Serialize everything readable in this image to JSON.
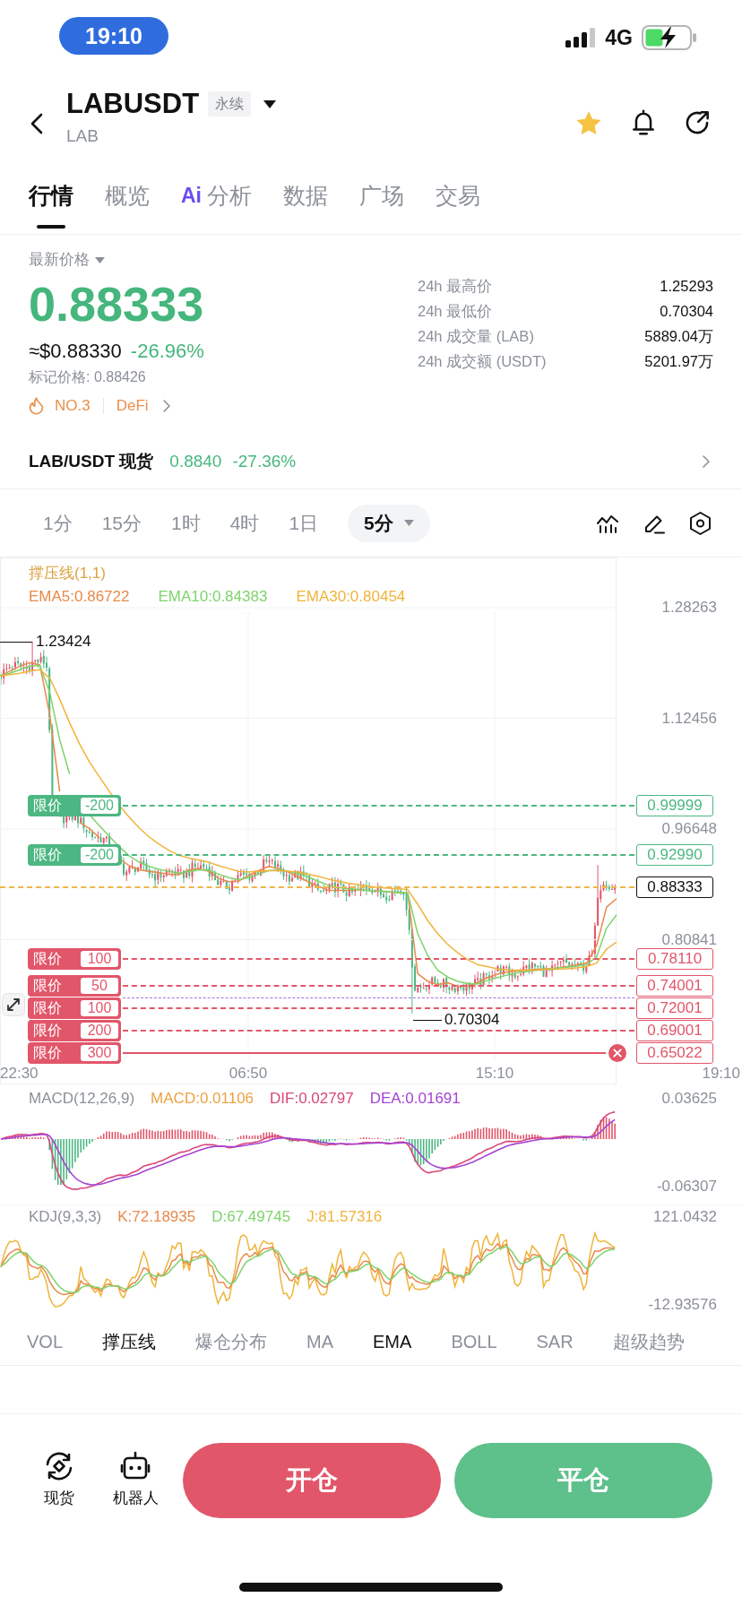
{
  "status_bar": {
    "time": "19:10",
    "network": "4G"
  },
  "header": {
    "symbol": "LABUSDT",
    "contract_type": "永续",
    "base_asset": "LAB",
    "favorite": true
  },
  "tabs": [
    {
      "label": "行情",
      "selected": true
    },
    {
      "label": "概览",
      "selected": false
    },
    {
      "label": "分析",
      "badge": "Ai",
      "selected": false
    },
    {
      "label": "数据",
      "selected": false
    },
    {
      "label": "广场",
      "selected": false
    },
    {
      "label": "交易",
      "selected": false
    }
  ],
  "price": {
    "label": "最新价格",
    "last": "0.88333",
    "usd": "≈$0.88330",
    "change": "-26.96%",
    "mark_price": "标记价格: 0.88426",
    "rank": "NO.3",
    "sector": "DeFi"
  },
  "stats": [
    {
      "label": "24h 最高价",
      "value": "1.25293"
    },
    {
      "label": "24h 最低价",
      "value": "0.70304"
    },
    {
      "label": "24h 成交量 (LAB)",
      "value": "5889.04万"
    },
    {
      "label": "24h 成交额 (USDT)",
      "value": "5201.97万"
    }
  ],
  "spot": {
    "label": "LAB/USDT 现货",
    "price": "0.8840",
    "change": "-27.36%"
  },
  "intervals": [
    {
      "label": "1分",
      "kind": "preset",
      "selected": false
    },
    {
      "label": "15分",
      "kind": "preset",
      "selected": false
    },
    {
      "label": "1时",
      "kind": "preset",
      "selected": false
    },
    {
      "label": "4时",
      "kind": "preset",
      "selected": false
    },
    {
      "label": "1日",
      "kind": "preset",
      "selected": false
    },
    {
      "label": "5分",
      "kind": "dropdown",
      "selected": true
    }
  ],
  "chart": {
    "overlay": "撑压线(1,1)",
    "ema_legend": [
      "EMA5:0.86722",
      "EMA10:0.84383",
      "EMA30:0.80454"
    ],
    "chart_data": {
      "type": "line",
      "series": [
        {
          "color": "#e8894a",
          "values": [
            1.185,
            1.192,
            1.199,
            1.204,
            1.201,
            1.13,
            1.02,
            null,
            0.976,
            0.967,
            0.954,
            null,
            0.924,
            0.914,
            0.908,
            0.906,
            0.904,
            0.902,
            0.901,
            0.908,
            0.91,
            0.906,
            0.896,
            0.891,
            0.892,
            0.9,
            0.907,
            0.913,
            0.91,
            0.905,
            0.898,
            0.891,
            0.885,
            0.879,
            0.879,
            0.879,
            0.88,
            0.879,
            0.878,
            0.877,
            0.876,
            0.875,
            0.76,
            0.749,
            0.744,
            0.747,
            0.742,
            0.742,
            0.747,
            0.754,
            0.759,
            0.762,
            0.764,
            0.765,
            0.766,
            0.767,
            0.768,
            0.77,
            0.772,
            0.775,
            0.8,
            0.855,
            0.867
          ]
        },
        {
          "color": "#7ed36a",
          "values": [
            1.185,
            1.189,
            1.194,
            1.199,
            1.2,
            1.162,
            1.094,
            1.045,
            null,
            0.987,
            0.971,
            0.956,
            0.941,
            0.928,
            0.919,
            0.913,
            0.909,
            0.906,
            0.903,
            0.906,
            0.908,
            0.908,
            0.902,
            0.897,
            0.894,
            0.897,
            0.902,
            0.907,
            0.908,
            0.906,
            0.903,
            0.898,
            0.892,
            0.886,
            0.883,
            0.881,
            0.88,
            0.879,
            0.878,
            0.877,
            0.876,
            0.875,
            0.817,
            0.786,
            0.765,
            0.755,
            0.749,
            0.746,
            0.745,
            0.75,
            0.754,
            0.758,
            0.761,
            0.763,
            0.765,
            0.766,
            0.768,
            0.769,
            0.771,
            0.773,
            0.784,
            0.825,
            0.844
          ]
        },
        {
          "color": "#f0b43a",
          "values": [
            1.185,
            1.187,
            1.189,
            1.192,
            1.194,
            1.182,
            1.152,
            1.118,
            1.088,
            1.062,
            1.041,
            1.02,
            1.0,
            0.983,
            0.968,
            0.955,
            0.945,
            0.936,
            0.929,
            0.925,
            0.922,
            0.919,
            0.914,
            0.91,
            0.906,
            0.905,
            0.906,
            0.907,
            0.907,
            0.906,
            0.905,
            0.902,
            0.899,
            0.895,
            0.892,
            0.889,
            0.887,
            0.885,
            0.883,
            0.882,
            0.881,
            0.88,
            0.859,
            0.836,
            0.817,
            0.802,
            0.79,
            0.78,
            0.773,
            0.77,
            0.767,
            0.765,
            0.765,
            0.765,
            0.765,
            0.766,
            0.766,
            0.767,
            0.768,
            0.77,
            0.775,
            0.795,
            0.805
          ]
        }
      ],
      "ylim": [
        0.60172,
        1.35431
      ],
      "yticks": [
        {
          "value": 1.28263,
          "label": "1.28263"
        },
        {
          "value": 1.12456,
          "label": "1.12456"
        },
        {
          "value": 0.96648,
          "label": "0.96648"
        },
        {
          "value": 0.80841,
          "label": "0.80841"
        }
      ],
      "grid": true
    },
    "time_axis": [
      "22:30",
      "06:50",
      "15:10",
      "19:10"
    ],
    "high_marker": "1.23424",
    "low_marker": "0.70304",
    "current_price": "0.88333",
    "orders": [
      {
        "label": "限价",
        "quantity": "-200",
        "price": "0.99999",
        "color": "#4cb782",
        "selected": false
      },
      {
        "label": "限价",
        "quantity": "-200",
        "price": "0.92990",
        "color": "#4cb782",
        "selected": false
      },
      {
        "label": "限价",
        "quantity": "100",
        "price": "0.78110",
        "color": "#e2566a",
        "selected": false
      },
      {
        "label": "限价",
        "quantity": "50",
        "price": "0.74001",
        "color": "#e2566a",
        "selected": false
      },
      {
        "label": "限价",
        "quantity": "100",
        "price": "0.72001",
        "color": "#e2566a",
        "selected": false
      },
      {
        "label": "限价",
        "quantity": "200",
        "price": "0.69001",
        "color": "#e2566a",
        "selected": false
      },
      {
        "label": "限价",
        "quantity": "300",
        "price": "0.65022",
        "color": "#e2566a",
        "selected": true
      }
    ]
  },
  "macd": {
    "title": "MACD(12,26,9)",
    "values": [
      {
        "label": "MACD:0.01106",
        "color": "#eda243"
      },
      {
        "label": "DIF:0.02797",
        "color": "#d9477a"
      },
      {
        "label": "DEA:0.01691",
        "color": "#a443d2"
      }
    ],
    "axis_max": "0.03625",
    "axis_min": "-0.06307"
  },
  "kdj": {
    "title": "KDJ(9,3,3)",
    "values": [
      {
        "label": "K:72.18935",
        "color": "#e8894a"
      },
      {
        "label": "D:67.49745",
        "color": "#7ed36a"
      },
      {
        "label": "J:81.57316",
        "color": "#f0b43a"
      }
    ],
    "axis_max": "121.0432",
    "axis_min": "-12.93576"
  },
  "indicators": [
    {
      "label": "VOL",
      "selected": false
    },
    {
      "label": "撑压线",
      "selected": true
    },
    {
      "label": "爆仓分布",
      "selected": false
    },
    {
      "label": "MA",
      "selected": false
    },
    {
      "label": "EMA",
      "selected": true
    },
    {
      "label": "BOLL",
      "selected": false
    },
    {
      "label": "SAR",
      "selected": false
    },
    {
      "label": "超级趋势",
      "selected": false
    }
  ],
  "bottom_bar": {
    "shortcuts": [
      {
        "kind": "spot",
        "label": "现货"
      },
      {
        "kind": "robot",
        "label": "机器人"
      }
    ],
    "actions": [
      {
        "kind": "open",
        "label": "开仓"
      },
      {
        "kind": "close",
        "label": "平仓"
      }
    ]
  }
}
